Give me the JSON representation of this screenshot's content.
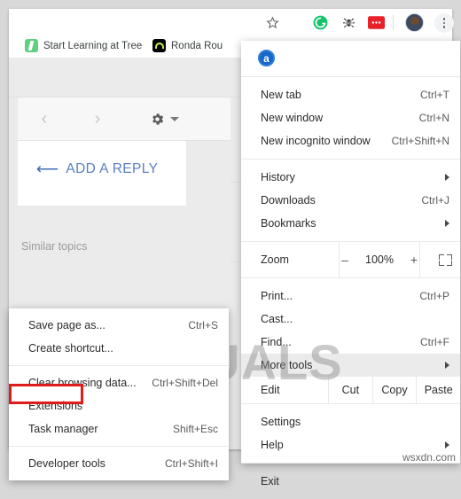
{
  "toolbar": {
    "icons": [
      {
        "name": "bookmark-star-icon",
        "glyph": "☆"
      },
      {
        "name": "grammarly-extension-icon",
        "glyph": "G"
      },
      {
        "name": "bug-extension-icon",
        "glyph": "§"
      },
      {
        "name": "red-extension-icon",
        "glyph": "…"
      }
    ],
    "avatar_label": "Profile",
    "menu_label": "Customize and control Google Chrome"
  },
  "bookmarks": [
    {
      "label": "Start Learning at Tree",
      "icon": "treehouse-favicon"
    },
    {
      "label": "Ronda Rou",
      "icon": "ronda-favicon"
    }
  ],
  "page": {
    "prev_label": "‹",
    "next_label": "›",
    "settings_icon": "gear-icon",
    "reply_button": "ADD A REPLY",
    "reply_icon": "reply-arrow-icon",
    "similar_topics": "Similar topics"
  },
  "watermark": {
    "brand": "APPUALS",
    "site": "wsxdn.com"
  },
  "chrome_menu": {
    "header_icon": "a-extension-icon",
    "header_icon_letter": "a",
    "groups": [
      {
        "items": [
          {
            "label": "New tab",
            "accel": "Ctrl+T",
            "submenu": false
          },
          {
            "label": "New window",
            "accel": "Ctrl+N",
            "submenu": false
          },
          {
            "label": "New incognito window",
            "accel": "Ctrl+Shift+N",
            "submenu": false
          }
        ]
      },
      {
        "items": [
          {
            "label": "History",
            "accel": "",
            "submenu": true
          },
          {
            "label": "Downloads",
            "accel": "Ctrl+J",
            "submenu": false
          },
          {
            "label": "Bookmarks",
            "accel": "",
            "submenu": true
          }
        ]
      }
    ],
    "zoom": {
      "label": "Zoom",
      "minus": "–",
      "value": "100%",
      "plus": "+",
      "fullscreen_icon": "fullscreen-icon"
    },
    "group3": {
      "items": [
        {
          "label": "Print...",
          "accel": "Ctrl+P",
          "submenu": false,
          "selected": false
        },
        {
          "label": "Cast...",
          "accel": "",
          "submenu": false,
          "selected": false
        },
        {
          "label": "Find...",
          "accel": "Ctrl+F",
          "submenu": false,
          "selected": false
        },
        {
          "label": "More tools",
          "accel": "",
          "submenu": true,
          "selected": true
        }
      ]
    },
    "edit_row": {
      "label": "Edit",
      "cut": "Cut",
      "copy": "Copy",
      "paste": "Paste"
    },
    "group4": {
      "items": [
        {
          "label": "Settings",
          "accel": "",
          "submenu": false
        },
        {
          "label": "Help",
          "accel": "",
          "submenu": true
        }
      ]
    },
    "group5": {
      "items": [
        {
          "label": "Exit",
          "accel": "",
          "submenu": false
        }
      ]
    }
  },
  "more_tools_submenu": {
    "groups": [
      {
        "items": [
          {
            "label": "Save page as...",
            "accel": "Ctrl+S"
          },
          {
            "label": "Create shortcut...",
            "accel": ""
          }
        ]
      },
      {
        "items": [
          {
            "label": "Clear browsing data...",
            "accel": "Ctrl+Shift+Del"
          },
          {
            "label": "Extensions",
            "accel": ""
          },
          {
            "label": "Task manager",
            "accel": "Shift+Esc"
          }
        ]
      },
      {
        "items": [
          {
            "label": "Developer tools",
            "accel": "Ctrl+Shift+I"
          }
        ]
      }
    ],
    "highlight_color": "#e01b1b"
  }
}
